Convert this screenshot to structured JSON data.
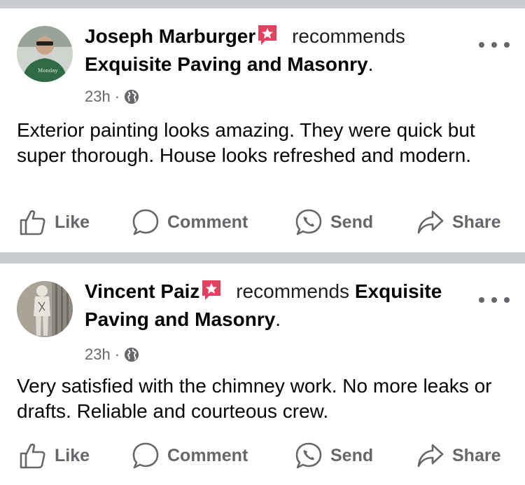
{
  "posts": [
    {
      "author": "Joseph Marburger",
      "verb": "recommends",
      "page": "Exquisite Paving and Masonry",
      "time": "23h",
      "separator": "·",
      "text": "Exterior painting looks amazing. They were quick but super thorough. House looks refreshed and modern.",
      "avatar_colors": {
        "bg": "#3e5f44",
        "shirt": "#2f6b45",
        "skin": "#c9a58a"
      }
    },
    {
      "author": "Vincent Paiz",
      "verb": "recommends",
      "page_part1": "Exquisite",
      "page_part2": "Paving and Masonry",
      "time": "23h",
      "separator": "·",
      "text": "Very satisfied with the chimney work. No more leaks or drafts. Reliable and courteous crew.",
      "avatar_colors": {
        "bg": "#b8b3aa",
        "suit": "#e8e4dc"
      }
    }
  ],
  "actions": {
    "like": "Like",
    "comment": "Comment",
    "send": "Send",
    "share": "Share"
  },
  "colors": {
    "badge": "#e4405f",
    "muted": "#65676b",
    "divider": "#c9ccd1"
  },
  "icons": [
    "recommend-star-icon",
    "globe-icon",
    "more-icon",
    "like-icon",
    "comment-icon",
    "send-icon",
    "share-icon"
  ]
}
